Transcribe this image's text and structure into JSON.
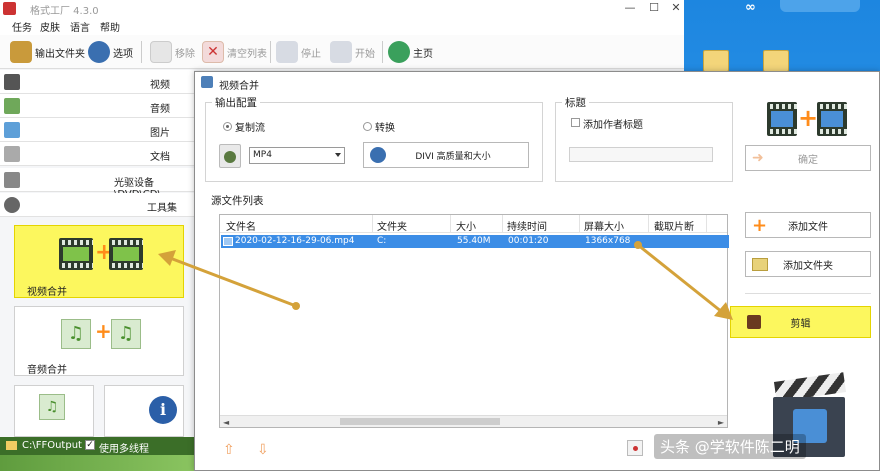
{
  "window": {
    "title": "格式工厂 4.3.0",
    "minimize": "—",
    "maximize": "☐",
    "close": "✕"
  },
  "menu": [
    "任务",
    "皮肤",
    "语言",
    "帮助"
  ],
  "toolbar": {
    "output_folder": "输出文件夹",
    "options": "选项",
    "remove": "移除",
    "clear_list": "清空列表",
    "stop": "停止",
    "start": "开始",
    "home": "主页"
  },
  "categories": [
    "视频",
    "音频",
    "图片",
    "文档",
    "光驱设备\\DVD\\CD\\",
    "工具集"
  ],
  "tiles": {
    "video_merge": "视频合并",
    "audio_merge": "音频合并"
  },
  "status": {
    "output_path": "C:\\FFOutput",
    "multithread_check": "✓",
    "multithread": "使用多线程"
  },
  "dialog": {
    "title": "视频合并",
    "output_config": "输出配置",
    "copy_stream": "复制流",
    "transcode": "转换",
    "format": "MP4",
    "quality": "DIVI 高质量和大小",
    "title_group": "标题",
    "add_author_title": "添加作者标题",
    "confirm": "确定",
    "source_list": "源文件列表",
    "columns": [
      "文件名",
      "文件夹",
      "大小",
      "持续时间",
      "屏幕大小",
      "截取片断"
    ],
    "rows": [
      {
        "name": "2020-02-12-16-29-06.mp4",
        "folder": "C:",
        "size": "55.40M",
        "duration": "00:01:20",
        "screen": "1366x768",
        "clip": ""
      }
    ],
    "add_file": "添加文件",
    "add_folder": "添加文件夹",
    "clip": "剪辑",
    "scroll_left": "◄",
    "scroll_right": "►"
  },
  "watermark": "头条 @学软件陈二明",
  "colors": {
    "highlight": "#fcf75e",
    "selection": "#3c8de6",
    "arrow": "#d4a23a"
  }
}
